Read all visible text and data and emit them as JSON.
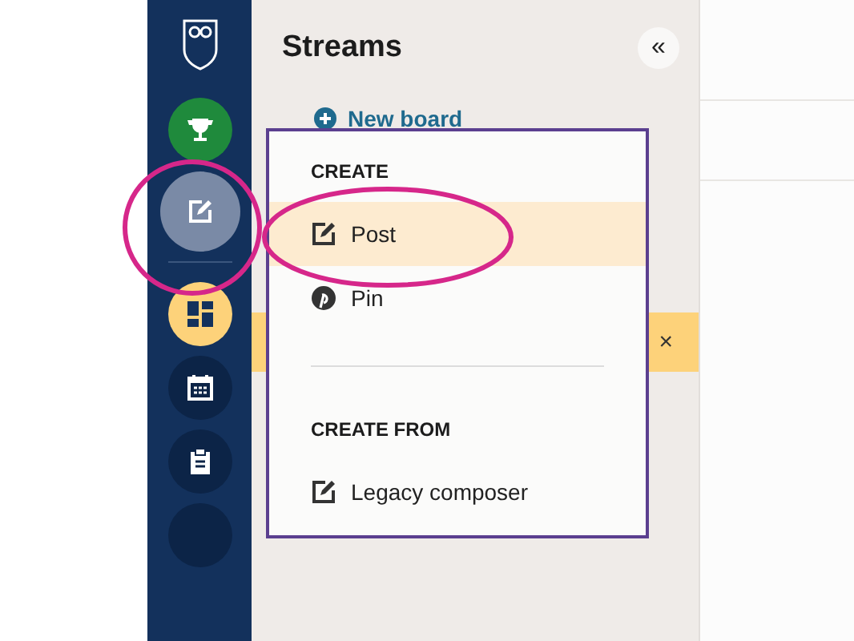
{
  "sidebar": {
    "items": [
      {
        "kind": "trophy",
        "color": "#1f8a3c",
        "selected": false
      },
      {
        "kind": "compose",
        "color": "#7a8aa6",
        "selected": true
      },
      {
        "kind": "dashboard",
        "color": "#fdd27a",
        "selected": false
      },
      {
        "kind": "calendar",
        "color": "#0c2447",
        "selected": false
      },
      {
        "kind": "clipboard",
        "color": "#0c2447",
        "selected": false
      },
      {
        "kind": "blank",
        "color": "#0c2447",
        "selected": false
      }
    ]
  },
  "panel": {
    "title": "Streams",
    "collapse_button": "«",
    "new_board": "New board",
    "banner": {
      "dismiss": "×"
    }
  },
  "menu": {
    "sections": [
      {
        "heading": "CREATE",
        "items": [
          {
            "label": "Post",
            "kind": "compose",
            "selected": true
          },
          {
            "label": "Pin",
            "kind": "pin",
            "selected": false
          }
        ]
      },
      {
        "heading": "CREATE FROM",
        "items": [
          {
            "label": "Legacy composer",
            "kind": "compose",
            "selected": false
          }
        ]
      }
    ]
  }
}
